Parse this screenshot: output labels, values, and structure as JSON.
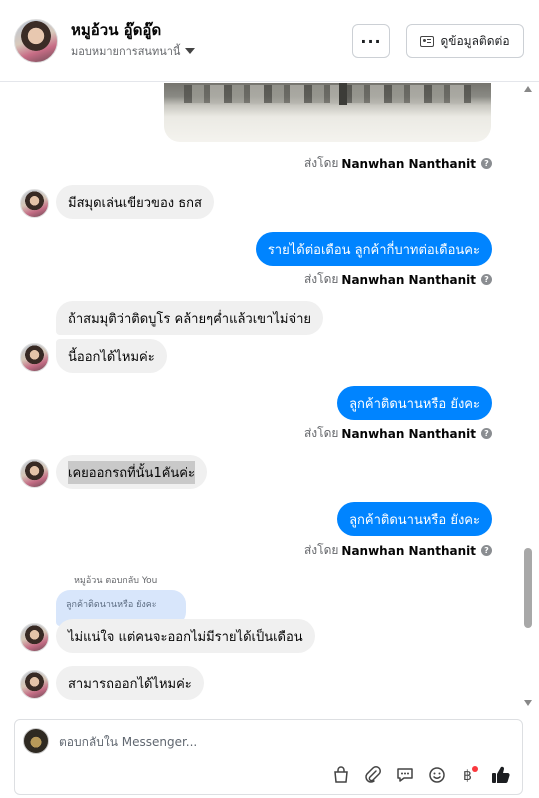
{
  "header": {
    "contact_name": "หมูอ้วน อู๊ดอู๊ด",
    "subtitle": "มอบหมายการสนทนานี้",
    "more_label": "···",
    "info_button_label": "ดูข้อมูลติดต่อ"
  },
  "thread": {
    "sent_by_prefix": "ส่งโดย",
    "agent_name": "Nanwhan Nanthanit",
    "messages": [
      {
        "dir": "in",
        "text": "มีสมุดเล่นเขียวของ ธกส"
      },
      {
        "dir": "out",
        "text": "รายได้ต่อเดือน ลูกค้ากี่บาทต่อเดือนคะ"
      },
      {
        "dir": "in",
        "text": "ถ้าสมมุติว่าติดบูโร คล้ายๆค่ำแล้วเขาไม่จ่าย"
      },
      {
        "dir": "in",
        "text": "นี้ออกได้ไหมค่ะ"
      },
      {
        "dir": "out",
        "text": "ลูกค้าติดนานหรือ ยังคะ"
      },
      {
        "dir": "in",
        "text": "เคยออกรถที่นั้น1คันค่ะ"
      },
      {
        "dir": "out",
        "text": "ลูกค้าติดนานหรือ ยังคะ"
      },
      {
        "dir": "in",
        "text": "ไม่แน่ใจ แต่คนจะออกไม่มีรายได้เป็นเดือน"
      },
      {
        "dir": "in",
        "text": "สามารถออกได้ไหมค่ะ"
      }
    ],
    "reply_label": "หมูอ้วน ตอบกลับ You",
    "reply_quote": "ลูกค้าติดนานหรือ ยังคะ"
  },
  "composer": {
    "placeholder": "ตอบกลับใน Messenger...",
    "tool_icons": [
      "shopping-bag-icon",
      "paperclip-icon",
      "chat-bubble-icon",
      "emoji-icon",
      "baht-payment-icon",
      "thumbs-up-icon"
    ]
  },
  "colors": {
    "outgoing_bubble": "#0084ff",
    "incoming_bubble": "#f0f0f0",
    "thumbs_up": "#1c1e21",
    "notification_dot": "#fa383e"
  }
}
